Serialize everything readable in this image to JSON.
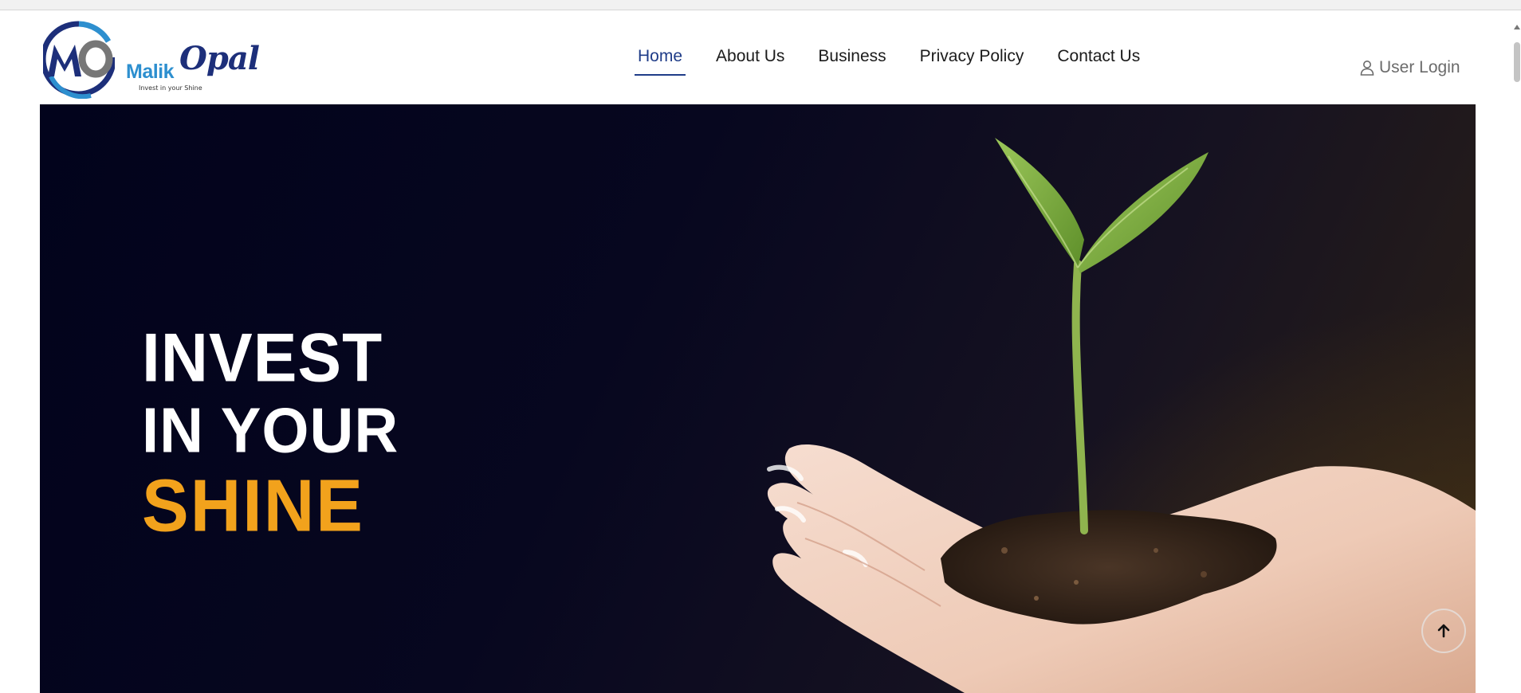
{
  "brand": {
    "mark_text": "MO",
    "name_part1": "Malik",
    "name_part2": "Opal",
    "tagline": "Invest in your Shine",
    "colors": {
      "blue": "#2d8fcf",
      "navy": "#1d2f7a",
      "grey": "#777777"
    }
  },
  "nav": {
    "items": [
      {
        "label": "Home",
        "active": true
      },
      {
        "label": "About Us",
        "active": false
      },
      {
        "label": "Business",
        "active": false
      },
      {
        "label": "Privacy Policy",
        "active": false
      },
      {
        "label": "Contact Us",
        "active": false
      }
    ],
    "active_color": "#1f3c88"
  },
  "user_login": {
    "label": "User Login",
    "icon": "user-icon"
  },
  "hero": {
    "line1": "INVEST",
    "line2": "IN YOUR",
    "line3": "SHINE",
    "accent_color": "#f2a21c",
    "image": "hand-holding-seedling"
  },
  "back_to_top": {
    "icon": "arrow-up-icon"
  }
}
